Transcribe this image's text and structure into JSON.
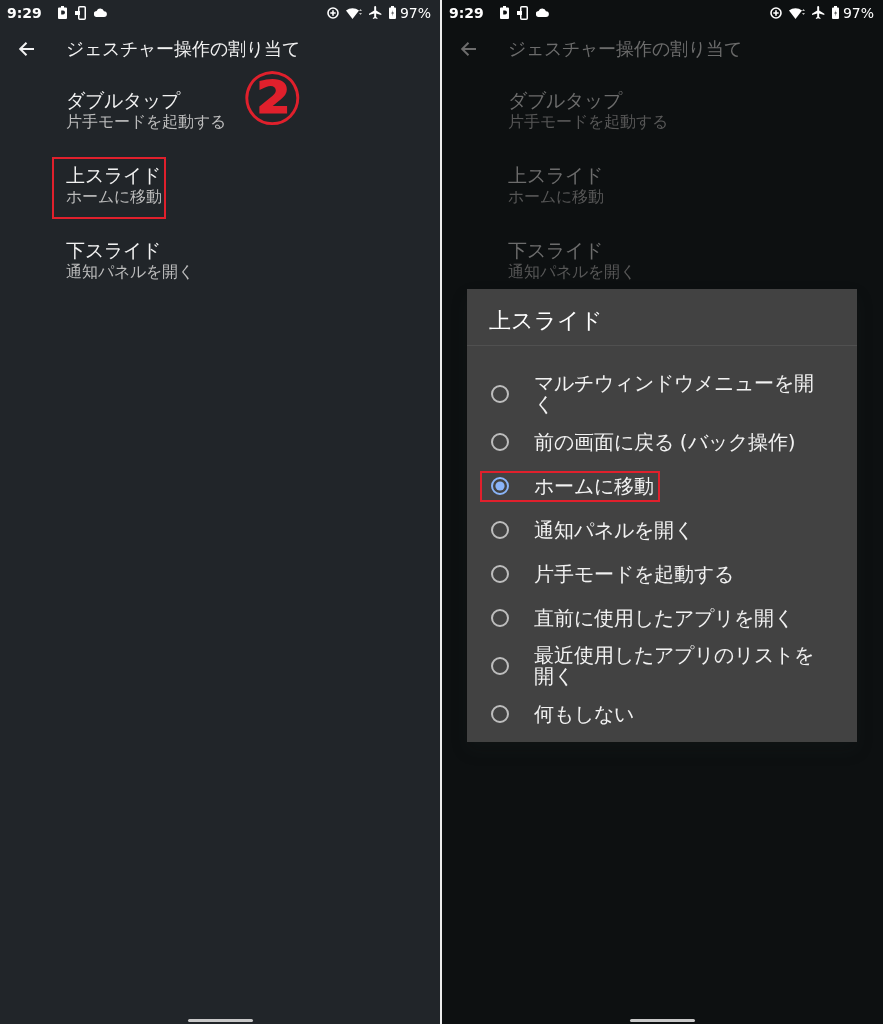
{
  "panels": [
    {
      "dimmed": false,
      "status_bar": {
        "time": "9:29",
        "battery": "97%"
      },
      "app_bar": {
        "title": "ジェスチャー操作の割り当て"
      },
      "settings": [
        {
          "title": "ダブルタップ",
          "summary": "片手モードを起動する",
          "highlighted": false
        },
        {
          "title": "上スライド",
          "summary": "ホームに移動",
          "highlighted": true
        },
        {
          "title": "下スライド",
          "summary": "通知パネルを開く",
          "highlighted": false
        }
      ],
      "step_marker": "②"
    },
    {
      "dimmed": true,
      "status_bar": {
        "time": "9:29",
        "battery": "97%"
      },
      "app_bar": {
        "title": "ジェスチャー操作の割り当て"
      },
      "settings": [
        {
          "title": "ダブルタップ",
          "summary": "片手モードを起動する",
          "highlighted": false
        },
        {
          "title": "上スライド",
          "summary": "ホームに移動",
          "highlighted": false
        },
        {
          "title": "下スライド",
          "summary": "通知パネルを開く",
          "highlighted": false
        }
      ],
      "dialog": {
        "title": "上スライド",
        "options": [
          {
            "label": "マルチウィンドウメニューを開く",
            "selected": false,
            "highlighted": false
          },
          {
            "label": "前の画面に戻る (バック操作)",
            "selected": false,
            "highlighted": false
          },
          {
            "label": "ホームに移動",
            "selected": true,
            "highlighted": true
          },
          {
            "label": "通知パネルを開く",
            "selected": false,
            "highlighted": false
          },
          {
            "label": "片手モードを起動する",
            "selected": false,
            "highlighted": false
          },
          {
            "label": "直前に使用したアプリを開く",
            "selected": false,
            "highlighted": false
          },
          {
            "label": "最近使用したアプリのリストを開く",
            "selected": false,
            "highlighted": false
          },
          {
            "label": "何もしない",
            "selected": false,
            "highlighted": false
          }
        ]
      }
    }
  ]
}
